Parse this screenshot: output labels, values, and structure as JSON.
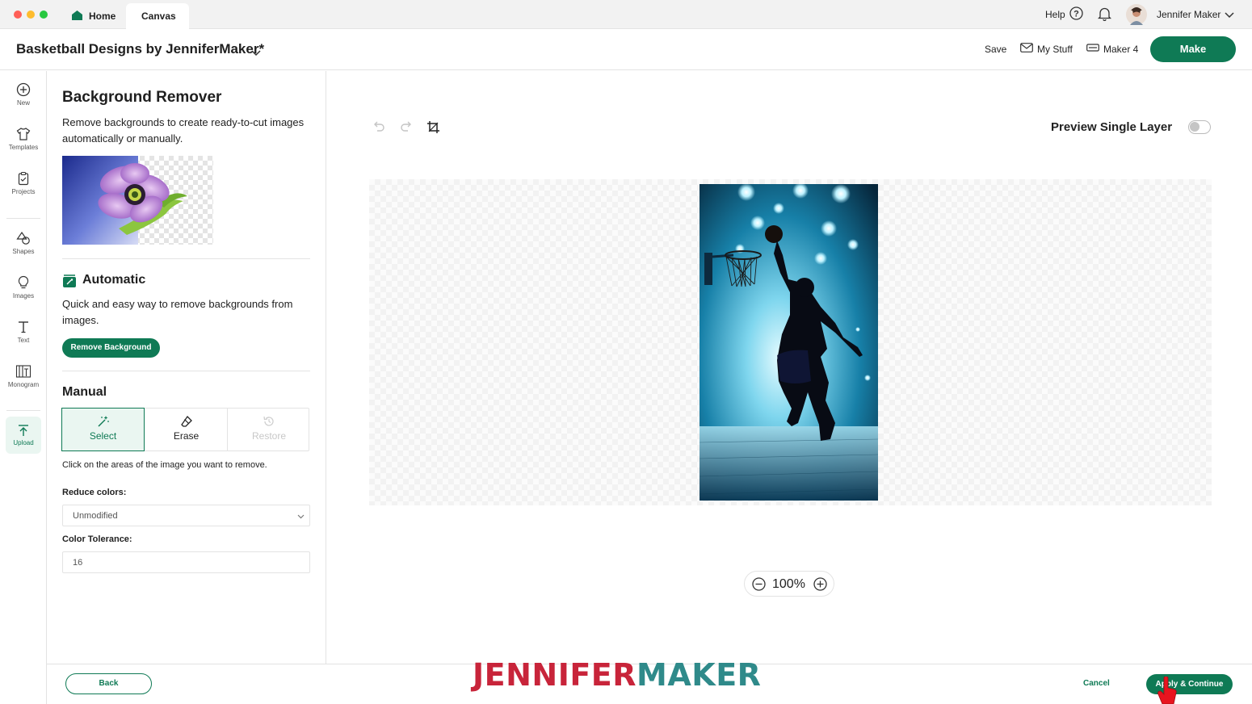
{
  "topbar": {
    "tabs": [
      {
        "label": "Home"
      },
      {
        "label": "Canvas"
      }
    ],
    "help_label": "Help",
    "user_name": "Jennifer Maker"
  },
  "header": {
    "project_title": "Basketball Designs by JenniferMaker*",
    "save_label": "Save",
    "my_stuff_label": "My Stuff",
    "machine_label": "Maker 4",
    "make_label": "Make"
  },
  "rail": {
    "items": [
      {
        "label": "New"
      },
      {
        "label": "Templates"
      },
      {
        "label": "Projects"
      },
      {
        "label": "Shapes"
      },
      {
        "label": "Images"
      },
      {
        "label": "Text"
      },
      {
        "label": "Monogram"
      },
      {
        "label": "Upload"
      }
    ]
  },
  "panel": {
    "title": "Background Remover",
    "description": "Remove backgrounds to create ready-to-cut images automatically or manually.",
    "automatic": {
      "title": "Automatic",
      "description": "Quick and easy way to remove backgrounds from images.",
      "button_label": "Remove Background"
    },
    "manual": {
      "title": "Manual",
      "tools": [
        {
          "label": "Select"
        },
        {
          "label": "Erase"
        },
        {
          "label": "Restore"
        }
      ],
      "hint": "Click on the areas of the image you want to remove.",
      "reduce_colors_label": "Reduce colors:",
      "reduce_colors_value": "Unmodified",
      "tolerance_label": "Color Tolerance:",
      "tolerance_value": "16"
    }
  },
  "canvas": {
    "preview_single_layer_label": "Preview Single Layer",
    "preview_single_layer_on": false,
    "zoom_value": "100%"
  },
  "footer": {
    "back_label": "Back",
    "cancel_label": "Cancel",
    "apply_label": "Apply & Continue"
  },
  "watermark": {
    "part_a": "JENNIFER",
    "part_b": "MAKER"
  },
  "colors": {
    "accent": "#0f7a55",
    "accent_light": "#eaf6f1",
    "watermark_red": "#c8243a",
    "watermark_teal": "#2f8a8a"
  }
}
